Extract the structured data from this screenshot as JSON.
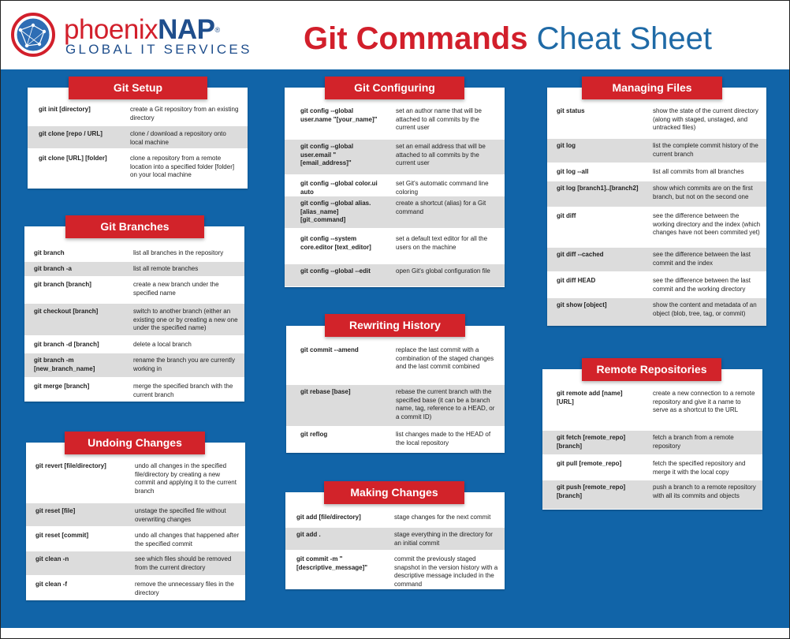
{
  "brand": {
    "name_part1": "phoenix",
    "name_part2": "NAP",
    "trademark": "®",
    "subtitle": "GLOBAL IT SERVICES"
  },
  "title": {
    "part1": "Git Commands",
    "part2": "Cheat Sheet"
  },
  "colors": {
    "accent_red": "#d2232a",
    "board_blue": "#1164a8",
    "row_gray": "#dcdcdc"
  },
  "sections": {
    "git_setup": {
      "title": "Git Setup",
      "rows": [
        {
          "cmd": "git init [directory]",
          "desc": "create a Git repository from an existing directory"
        },
        {
          "cmd": "git clone [repo / URL]",
          "desc": "clone / download a repository onto local machine"
        },
        {
          "cmd": "git clone [URL] [folder]",
          "desc": "clone a repository from a remote location into a specified folder [folder] on your local machine"
        }
      ]
    },
    "git_branches": {
      "title": "Git Branches",
      "rows": [
        {
          "cmd": "git branch",
          "desc": "list all branches in the repository"
        },
        {
          "cmd": "git branch -a",
          "desc": "list all remote branches"
        },
        {
          "cmd": "git branch [branch]",
          "desc": "create a new branch under the specified name"
        },
        {
          "cmd": "git checkout [branch]",
          "desc": "switch to another branch (either an existing one or by creating a new one under the specified name)"
        },
        {
          "cmd": "git branch -d [branch]",
          "desc": "delete a local branch"
        },
        {
          "cmd": "git branch -m [new_branch_name]",
          "desc": "rename the branch you are currently working in"
        },
        {
          "cmd": "git merge [branch]",
          "desc": "merge the specified branch with the current branch"
        }
      ]
    },
    "undoing_changes": {
      "title": "Undoing Changes",
      "rows": [
        {
          "cmd": "git revert [file/directory]",
          "desc": "undo all changes in the specified file/directory by creating a new commit and applying it to the current branch"
        },
        {
          "cmd": "git reset [file]",
          "desc": "unstage the specified file without overwriting changes"
        },
        {
          "cmd": "git reset [commit]",
          "desc": "undo all changes that happened after the specified commit"
        },
        {
          "cmd": "git clean -n",
          "desc": "see which files should be removed from the current directory"
        },
        {
          "cmd": "git clean -f",
          "desc": "remove the unnecessary files in the directory"
        }
      ]
    },
    "git_configuring": {
      "title": "Git Configuring",
      "rows": [
        {
          "cmd": "git config --global user.name \"[your_name]\"",
          "desc": "set an author name that will be attached to all commits by the current user"
        },
        {
          "cmd": "git config --global user.email \"[email_address]\"",
          "desc": "set an email address that will be attached to all commits by the current user"
        },
        {
          "cmd": "git config --global color.ui auto",
          "desc": "set Git's automatic command line coloring"
        },
        {
          "cmd": "git config --global alias.[alias_name] [git_command]",
          "desc": "create a shortcut (alias) for a Git command"
        },
        {
          "cmd": "git config --system core.editor [text_editor]",
          "desc": "set a default text editor for all the users on the machine"
        },
        {
          "cmd": "git config --global --edit",
          "desc": "open Git's global configuration file"
        }
      ]
    },
    "rewriting_history": {
      "title": "Rewriting History",
      "rows": [
        {
          "cmd": "git commit --amend",
          "desc": "replace the last commit with a combination of the staged changes and the last commit combined"
        },
        {
          "cmd": "git rebase [base]",
          "desc": "rebase the current branch with the specified base (it can be a branch name, tag, reference to a HEAD, or a commit ID)"
        },
        {
          "cmd": "git reflog",
          "desc": "list changes made to the HEAD of the local repository"
        }
      ]
    },
    "making_changes": {
      "title": "Making Changes",
      "rows": [
        {
          "cmd": "git add [file/directory]",
          "desc": "stage changes for the next commit"
        },
        {
          "cmd": "git add .",
          "desc": "stage everything in the directory for an initial commit"
        },
        {
          "cmd": "git commit -m \"[descriptive_message]\"",
          "desc": "commit the previously staged snapshot in the version history with a descriptive message included in the command"
        }
      ]
    },
    "managing_files": {
      "title": "Managing Files",
      "rows": [
        {
          "cmd": "git status",
          "desc": "show the state of the current directory (along with staged, unstaged, and untracked files)"
        },
        {
          "cmd": "git log",
          "desc": "list the complete commit history of the current branch"
        },
        {
          "cmd": "git log --all",
          "desc": "list all commits from all branches"
        },
        {
          "cmd": "git log [branch1]..[branch2]",
          "desc": "show which commits are on the first branch, but not on the second one"
        },
        {
          "cmd": "git diff",
          "desc": "see the difference between the working directory and the index (which changes have not been commited yet)"
        },
        {
          "cmd": "git diff --cached",
          "desc": "see the difference between the last commit and the index"
        },
        {
          "cmd": "git diff HEAD",
          "desc": "see the difference between the last commit and the working directory"
        },
        {
          "cmd": "git show [object]",
          "desc": "show the content and metadata of an object (blob, tree, tag, or commit)"
        }
      ]
    },
    "remote_repositories": {
      "title": "Remote Repositories",
      "rows": [
        {
          "cmd": "git remote add [name] [URL]",
          "desc": "create a new connection to a remote repository and give it a name to serve as a shortcut to the URL"
        },
        {
          "cmd": "git fetch [remote_repo] [branch]",
          "desc": "fetch a branch from a remote repository"
        },
        {
          "cmd": "git pull [remote_repo]",
          "desc": "fetch the specified repository and merge it with the local copy"
        },
        {
          "cmd": "git push [remote_repo] [branch]",
          "desc": "push a branch to a remote repository with all its commits and objects"
        }
      ]
    }
  }
}
